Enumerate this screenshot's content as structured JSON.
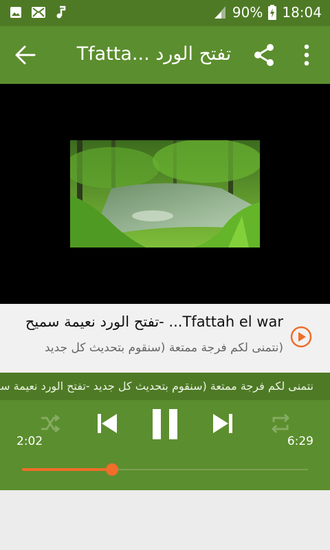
{
  "status": {
    "battery": "90%",
    "time": "18:04"
  },
  "appbar": {
    "title": "Tfatta... تفتح الورد"
  },
  "track": {
    "title": "Tfattah el war... -تفتح الورد نعيمة سميح",
    "subtitle": "(نتمنى لكم فرجة ممتعة (سنقوم بتحديث كل جديد"
  },
  "player": {
    "ticker": "Tfattah el ward Naima Samih- ((نتمنى لكم فرجة ممتعة (سنقوم بتحديث كل جديد -تفتح الورد نعيمة سميح",
    "elapsed": "2:02",
    "duration": "6:29",
    "progress": 0.315
  },
  "colors": {
    "accent": "#f06d2a",
    "primary": "#5b8e2e",
    "primary_dark": "#4e7a25"
  }
}
